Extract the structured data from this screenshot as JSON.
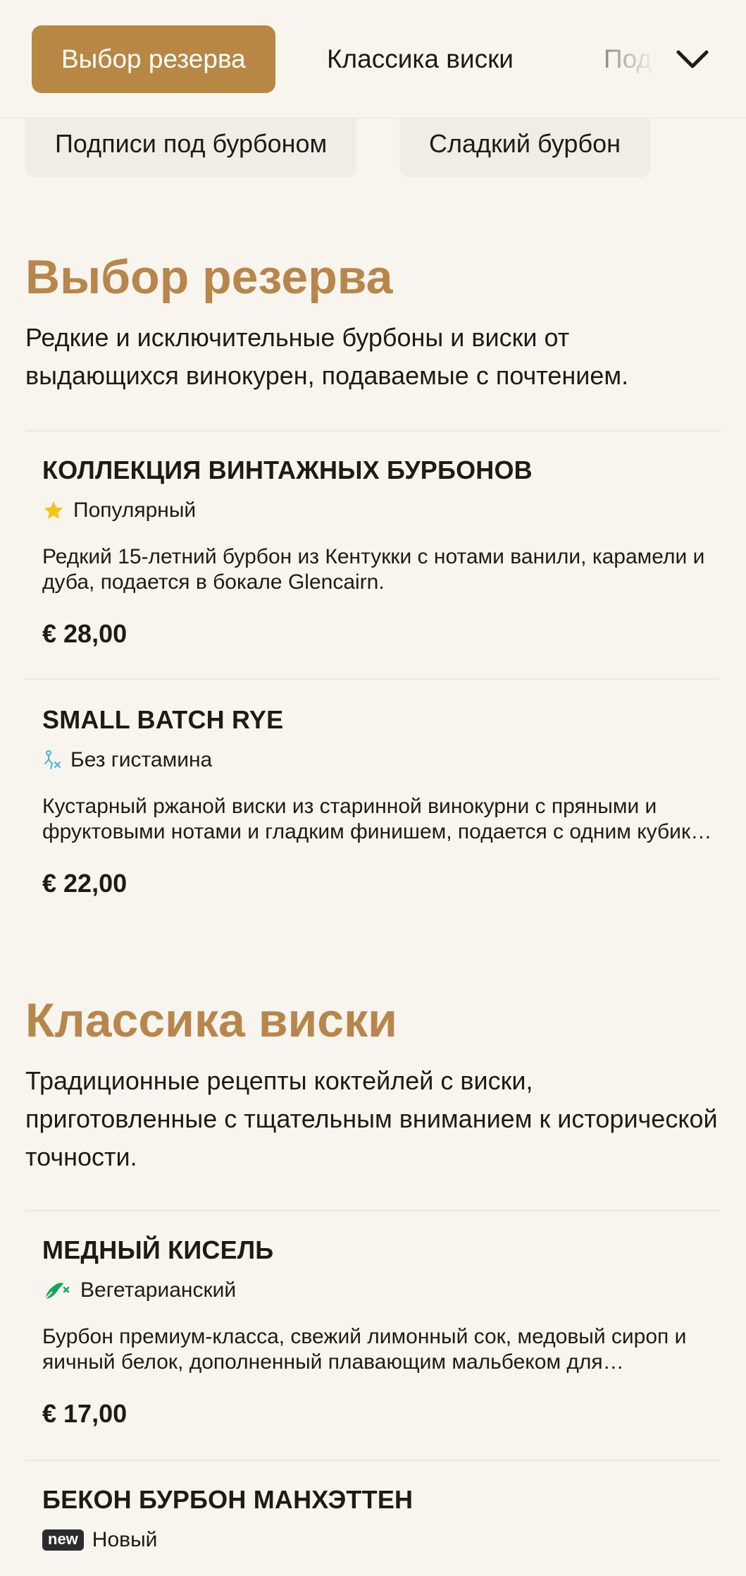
{
  "tabs": [
    {
      "label": "Выбор резерва",
      "active": true
    },
    {
      "label": "Классика виски",
      "active": false
    },
    {
      "label": "Подписи под бурбоном",
      "active": false
    }
  ],
  "chips": [
    {
      "label": "Подписи под бурбоном"
    },
    {
      "label": "Сладкий бурбон"
    }
  ],
  "sections": [
    {
      "title": "Выбор резерва",
      "description": "Редкие и исключительные бурбоны и виски от выдающихся винокурен, подаваемые с почтением.",
      "items": [
        {
          "name": "КОЛЛЕКЦИЯ ВИНТАЖНЫХ БУРБОНОВ",
          "badge_icon": "star-icon",
          "badge": "Популярный",
          "description": "Редкий 15-летний бурбон из Кентукки с нотами ванили, карамели и дуба, подается в бокале Glencairn.",
          "price": "€ 28,00"
        },
        {
          "name": "SMALL BATCH RYE",
          "badge_icon": "histamine-free-icon",
          "badge": "Без гистамина",
          "description": "Кустарный ржаной виски из старинной винокурни с пряными и фруктовыми нотами и гладким финишем, подается с одним кубиком льда.",
          "price": "€ 22,00"
        }
      ]
    },
    {
      "title": "Классика виски",
      "description": "Традиционные рецепты коктейлей с виски, приготовленные с тщательным вниманием к исторической точности.",
      "items": [
        {
          "name": "МЕДНЫЙ КИСЕЛЬ",
          "badge_icon": "vegetarian-icon",
          "badge": "Вегетарианский",
          "description": "Бурбон премиум-класса, свежий лимонный сок, медовый сироп и яичный белок, дополненный плавающим мальбеком для элегантной подачи.",
          "price": "€ 17,00"
        },
        {
          "name": "БЕКОН БУРБОН МАНХЭТТЕН",
          "badge_icon": "new-tag-icon",
          "badge_tag": "new",
          "badge": "Новый"
        }
      ]
    }
  ],
  "colors": {
    "accent": "#b98744",
    "section_title": "#b8864a",
    "background": "#f8f5ef",
    "chip_bg": "#f1ede6",
    "star": "#f5c518",
    "histamine": "#3fb6d8",
    "vegetarian": "#17a55c"
  }
}
